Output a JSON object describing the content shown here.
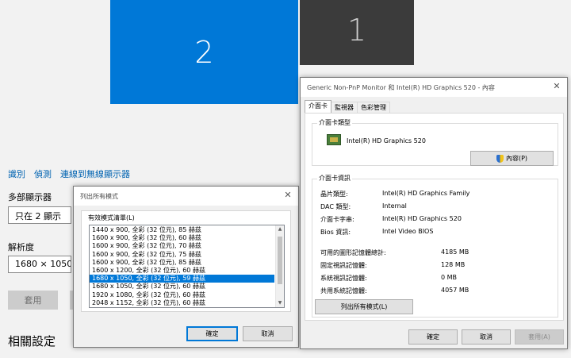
{
  "settings": {
    "monitors": [
      {
        "id": "2",
        "label": "2",
        "selected": true
      },
      {
        "id": "1",
        "label": "1",
        "selected": false
      }
    ],
    "links": [
      "識別",
      "偵測",
      "連線到無線顯示器"
    ],
    "multi_display_label": "多部顯示器",
    "multi_display_value": "只在 2 顯示",
    "resolution_label": "解析度",
    "resolution_value": "1680 × 1050",
    "apply_label": "套用",
    "related_settings_title": "相關設定"
  },
  "list_dialog": {
    "title": "列出所有模式",
    "group_label": "有效模式清單(L)",
    "modes": [
      "1440 x 900, 全彩 (32 位元), 85 赫茲",
      "1600 x 900, 全彩 (32 位元), 60 赫茲",
      "1600 x 900, 全彩 (32 位元), 70 赫茲",
      "1600 x 900, 全彩 (32 位元), 75 赫茲",
      "1600 x 900, 全彩 (32 位元), 85 赫茲",
      "1600 x 1200, 全彩 (32 位元), 60 赫茲",
      "1680 x 1050, 全彩 (32 位元), 59 赫茲",
      "1680 x 1050, 全彩 (32 位元), 60 赫茲",
      "1920 x 1080, 全彩 (32 位元), 60 赫茲",
      "2048 x 1152, 全彩 (32 位元), 60 赫茲"
    ],
    "selected_index": 6,
    "ok_label": "確定",
    "cancel_label": "取消"
  },
  "props_dialog": {
    "title": "Generic Non-PnP Monitor 和 Intel(R) HD Graphics 520 - 內容",
    "tabs": [
      "介面卡",
      "監視器",
      "色彩管理"
    ],
    "active_tab": 0,
    "adapter_type_caption": "介面卡類型",
    "adapter_name": "Intel(R) HD Graphics 520",
    "properties_button": "內容(P)",
    "adapter_info_caption": "介面卡資訊",
    "info": [
      {
        "key": "晶片類型:",
        "value": "Intel(R) HD Graphics Family"
      },
      {
        "key": "DAC 類型:",
        "value": "Internal"
      },
      {
        "key": "介面卡字串:",
        "value": "Intel(R) HD Graphics 520"
      },
      {
        "key": "Bios 資訊:",
        "value": "Intel Video BIOS"
      }
    ],
    "memory": [
      {
        "key": "可用的圖形記憶體總計:",
        "value": "4185 MB"
      },
      {
        "key": "固定視訊記憶體:",
        "value": "128 MB"
      },
      {
        "key": "系統視訊記憶體:",
        "value": "0 MB"
      },
      {
        "key": "共用系統記憶體:",
        "value": "4057 MB"
      }
    ],
    "list_all_button": "列出所有模式(L)",
    "ok_label": "確定",
    "cancel_label": "取消",
    "apply_label": "套用(A)"
  }
}
